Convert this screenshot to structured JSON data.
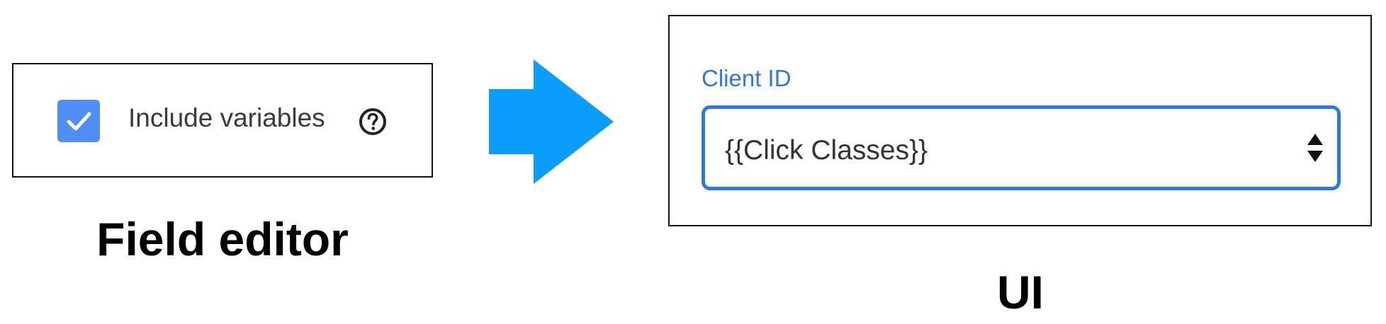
{
  "field_editor": {
    "checkbox_checked": true,
    "checkbox_label": "Include variables",
    "help_icon": "question-circle-icon",
    "caption": "Field editor",
    "checkbox_color": "#4f8ef7"
  },
  "arrow": {
    "icon": "right-arrow-icon",
    "color": "#0a9dfb"
  },
  "ui": {
    "field_label": "Client ID",
    "select_value": "{{Click Classes}}",
    "select_icon": "sort-arrows-icon",
    "caption": "UI",
    "accent_color": "#2f78e0"
  }
}
